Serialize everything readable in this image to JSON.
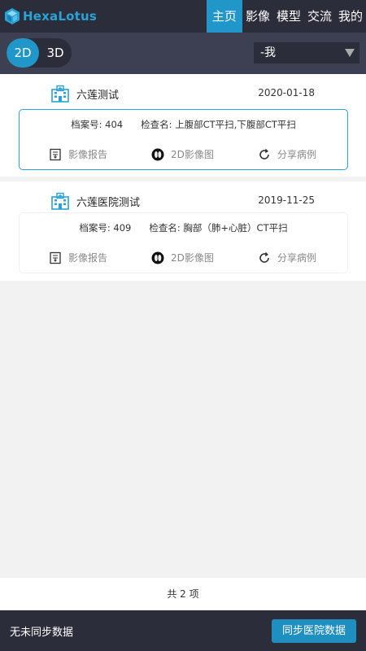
{
  "app": {
    "brand": "HexaLotus"
  },
  "nav": {
    "tabs": [
      {
        "label": "主页",
        "active": true
      },
      {
        "label": "影像"
      },
      {
        "label": "模型"
      },
      {
        "label": "交流"
      },
      {
        "label": "我的"
      }
    ]
  },
  "view_toggle": {
    "options": [
      "2D",
      "3D"
    ],
    "selected": "2D"
  },
  "filter_select": {
    "value": "-我"
  },
  "records": [
    {
      "hospital": "六莲测试",
      "date": "2020-01-18",
      "archive": "档案号: 404",
      "exam": "检查名: 上腹部CT平扫,下腹部CT平扫",
      "actions": {
        "report": "影像报告",
        "image2d": "2D影像图",
        "share": "分享病例"
      }
    },
    {
      "hospital": "六莲医院测试",
      "date": "2019-11-25",
      "archive": "档案号: 409",
      "exam": "检查名: 胸部（肺+心脏）CT平扫",
      "actions": {
        "report": "影像报告",
        "image2d": "2D影像图",
        "share": "分享病例"
      }
    }
  ],
  "pagination": {
    "total_text": "共 2 项"
  },
  "sync": {
    "status": "无未同步数据",
    "button_label": "同步医院数据"
  },
  "colors": {
    "accent": "#2196c8",
    "nav_bg": "#2b2d3a",
    "subbar_bg": "#3d3f52"
  }
}
